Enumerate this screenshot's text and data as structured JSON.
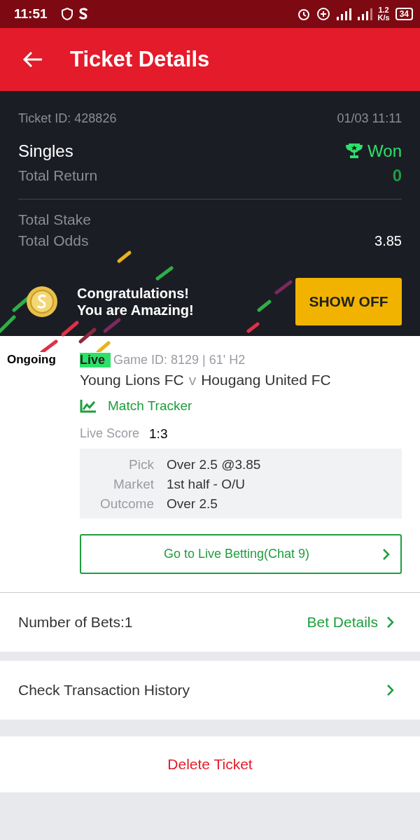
{
  "status_bar": {
    "time": "11:51",
    "speed_value": "1.2",
    "speed_unit": "K/s",
    "battery": "34"
  },
  "header": {
    "title": "Ticket Details"
  },
  "ticket": {
    "id_label": "Ticket ID: 428826",
    "datetime": "01/03 11:11",
    "type": "Singles",
    "status": "Won",
    "total_return_label": "Total Return",
    "total_return_value": "0",
    "total_stake_label": "Total Stake",
    "total_odds_label": "Total Odds",
    "total_odds_value": "3.85"
  },
  "banner": {
    "line1": "Congratulations!",
    "line2": "You are Amazing!",
    "button": "SHOW OFF"
  },
  "selection": {
    "state": "Ongoing",
    "live_badge": "Live",
    "game_info": "Game ID: 8129 | 61' H2",
    "home": "Young Lions FC",
    "versus": "v",
    "away": "Hougang United FC",
    "tracker": "Match Tracker",
    "score_label": "Live Score",
    "score": "1:3",
    "details": [
      {
        "label": "Pick",
        "value": "Over 2.5 @3.85"
      },
      {
        "label": "Market",
        "value": "1st half - O/U"
      },
      {
        "label": "Outcome",
        "value": "Over 2.5"
      }
    ],
    "live_button": "Go to Live Betting(Chat 9)"
  },
  "bets_row": {
    "label": "Number of Bets:1",
    "link": "Bet Details"
  },
  "history_row": {
    "label": "Check Transaction History"
  },
  "delete_button": "Delete Ticket"
}
